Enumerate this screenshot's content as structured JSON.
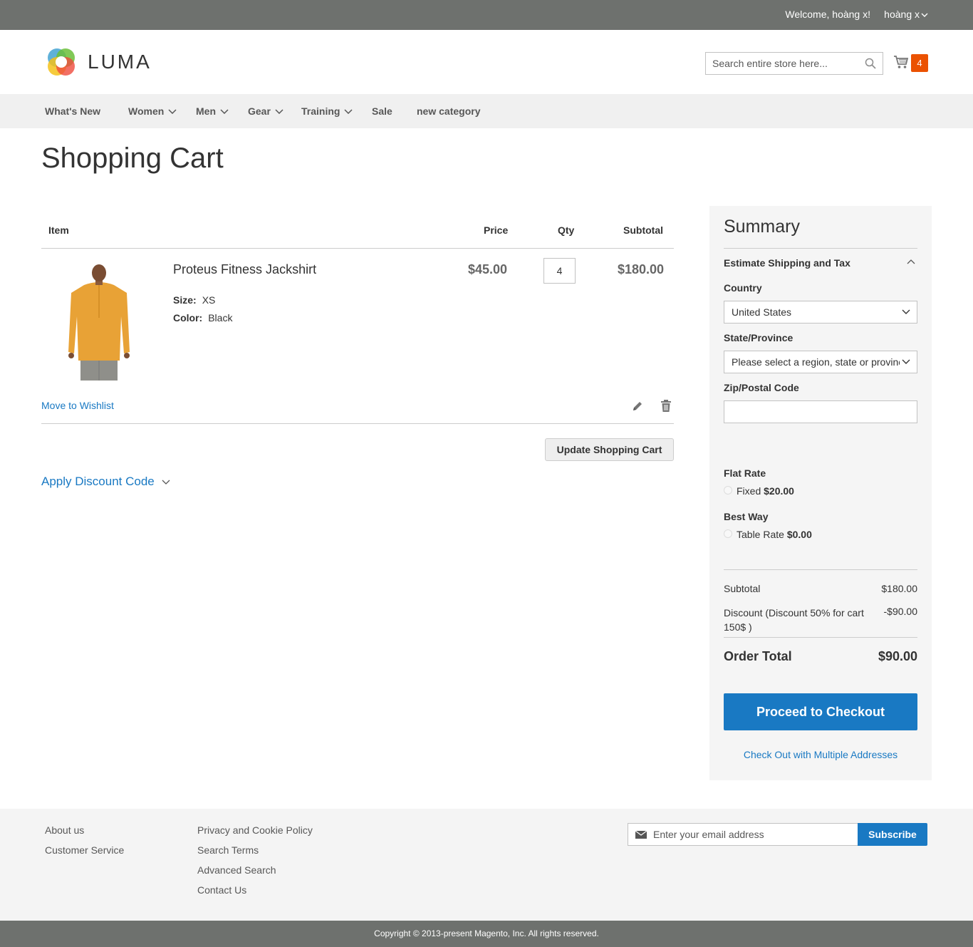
{
  "topbar": {
    "welcome": "Welcome, hoàng x!",
    "account": "hoàng x"
  },
  "header": {
    "logo_text": "LUMA",
    "search_placeholder": "Search entire store here...",
    "cart_count": "4"
  },
  "nav": {
    "items": [
      {
        "label": "What's New"
      },
      {
        "label": "Women"
      },
      {
        "label": "Men"
      },
      {
        "label": "Gear"
      },
      {
        "label": "Training"
      },
      {
        "label": "Sale"
      },
      {
        "label": "new category"
      }
    ]
  },
  "page_title": "Shopping Cart",
  "cart": {
    "headers": {
      "item": "Item",
      "price": "Price",
      "qty": "Qty",
      "subtotal": "Subtotal"
    },
    "item": {
      "name": "Proteus Fitness Jackshirt",
      "size_label": "Size:",
      "size": "XS",
      "color_label": "Color:",
      "color": "Black",
      "price": "$45.00",
      "qty": "4",
      "subtotal": "$180.00",
      "move_to_wishlist": "Move to Wishlist"
    },
    "update_button": "Update Shopping Cart",
    "discount_label": "Apply Discount Code"
  },
  "summary": {
    "title": "Summary",
    "estimate_label": "Estimate Shipping and Tax",
    "country_label": "Country",
    "country_value": "United States",
    "state_label": "State/Province",
    "state_value": "Please select a region, state or province.",
    "zip_label": "Zip/Postal Code",
    "zip_value": "",
    "flat_rate": {
      "title": "Flat Rate",
      "option": "Fixed",
      "amount": "$20.00"
    },
    "best_way": {
      "title": "Best Way",
      "option": "Table Rate",
      "amount": "$0.00"
    },
    "subtotal_label": "Subtotal",
    "subtotal_value": "$180.00",
    "discount_label": "Discount (Discount 50% for cart 150$ )",
    "discount_value": "-$90.00",
    "order_total_label": "Order Total",
    "order_total_value": "$90.00",
    "checkout_button": "Proceed to Checkout",
    "multi_address": "Check Out with Multiple Addresses"
  },
  "footer": {
    "col1": [
      "About us",
      "Customer Service"
    ],
    "col2": [
      "Privacy and Cookie Policy",
      "Search Terms",
      "Advanced Search",
      "Contact Us"
    ],
    "newsletter_placeholder": "Enter your email address",
    "subscribe": "Subscribe",
    "copyright": "Copyright © 2013-present Magento, Inc. All rights reserved."
  },
  "colors": {
    "accent": "#1979c3",
    "topbar": "#6e716e",
    "cart_badge": "#eb5202",
    "nav_bg": "#f0f0f0",
    "summary_bg": "#f5f5f5",
    "product_shirt": "#e8a236"
  },
  "icons": [
    "chevron-down-icon",
    "search-icon",
    "cart-icon",
    "pencil-icon",
    "trash-icon",
    "chevron-up-icon",
    "mail-icon"
  ]
}
